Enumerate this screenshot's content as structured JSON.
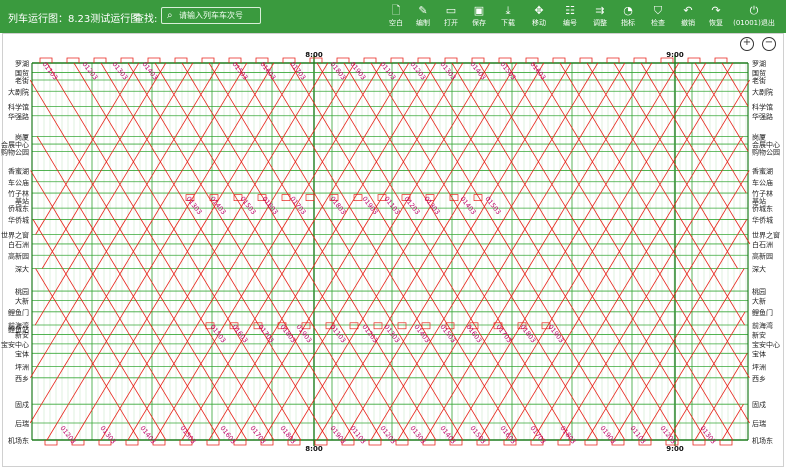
{
  "header": {
    "title": "列车运行图：8.23测试运行图",
    "search_label": "查找:",
    "search_placeholder": "请输入列车车次号"
  },
  "toolbar": [
    {
      "key": "blank",
      "label": "空白",
      "icon": "file-icon"
    },
    {
      "key": "edit",
      "label": "编制",
      "icon": "pencil-icon"
    },
    {
      "key": "open",
      "label": "打开",
      "icon": "folder-icon"
    },
    {
      "key": "save",
      "label": "保存",
      "icon": "save-icon"
    },
    {
      "key": "download",
      "label": "下载",
      "icon": "download-icon"
    },
    {
      "key": "move",
      "label": "移动",
      "icon": "move-icon"
    },
    {
      "key": "number",
      "label": "编号",
      "icon": "grid-icon"
    },
    {
      "key": "adjust",
      "label": "调整",
      "icon": "sliders-icon"
    },
    {
      "key": "metrics",
      "label": "指标",
      "icon": "chart-icon"
    },
    {
      "key": "check",
      "label": "检查",
      "icon": "shield-icon"
    },
    {
      "key": "undo",
      "label": "撤销",
      "icon": "undo-icon"
    },
    {
      "key": "redo",
      "label": "恢复",
      "icon": "redo-icon"
    },
    {
      "key": "logout",
      "label": "(01001)退出",
      "icon": "power-icon"
    }
  ],
  "zoom": {
    "in": "⊕",
    "out": "⊖"
  },
  "time_labels": [
    "8:00",
    "9:00"
  ],
  "stations": [
    {
      "name": "罗湖",
      "p": 0.0
    },
    {
      "name": "国贸",
      "p": 0.025
    },
    {
      "name": "老街",
      "p": 0.045
    },
    {
      "name": "大剧院",
      "p": 0.075
    },
    {
      "name": "科学馆",
      "p": 0.115
    },
    {
      "name": "华强路",
      "p": 0.14
    },
    {
      "name": "岗厦",
      "p": 0.195
    },
    {
      "name": "会展中心",
      "p": 0.215
    },
    {
      "name": "购物公园",
      "p": 0.235
    },
    {
      "name": "香蜜湖",
      "p": 0.285
    },
    {
      "name": "车公庙",
      "p": 0.315
    },
    {
      "name": "竹子林",
      "p": 0.345
    },
    {
      "name": "侨城东",
      "p": 0.385
    },
    {
      "name": "华侨城",
      "p": 0.415
    },
    {
      "name": "世界之窗",
      "p": 0.455
    },
    {
      "name": "白石洲",
      "p": 0.48
    },
    {
      "name": "高新园",
      "p": 0.51
    },
    {
      "name": "深大",
      "p": 0.545
    },
    {
      "name": "桃园",
      "p": 0.605
    },
    {
      "name": "大新",
      "p": 0.63
    },
    {
      "name": "鲤鱼门",
      "p": 0.66
    },
    {
      "name": "前海湾",
      "p": 0.695
    },
    {
      "name": "新安",
      "p": 0.72
    },
    {
      "name": "宝安中心",
      "p": 0.745
    },
    {
      "name": "宝体",
      "p": 0.77
    },
    {
      "name": "坪洲",
      "p": 0.805
    },
    {
      "name": "西乡",
      "p": 0.835
    },
    {
      "name": "固戍",
      "p": 0.905
    },
    {
      "name": "后瑞",
      "p": 0.955
    },
    {
      "name": "机场东",
      "p": 1.0
    }
  ],
  "station_labels_left_extra": [
    {
      "name": "基站",
      "p": 0.365
    },
    {
      "name": "鲤鱼站",
      "p": 0.705
    }
  ],
  "station_labels_right_extra": [
    {
      "name": "基站",
      "p": 0.365
    }
  ],
  "train_labels": [
    "01103",
    "01203",
    "01303",
    "01403",
    "01503",
    "01603",
    "01703",
    "01803",
    "01903"
  ],
  "colors": {
    "header": "#3a9a3e",
    "grid": "#39a839",
    "train": "#e8251c",
    "label": "#c0006a"
  }
}
